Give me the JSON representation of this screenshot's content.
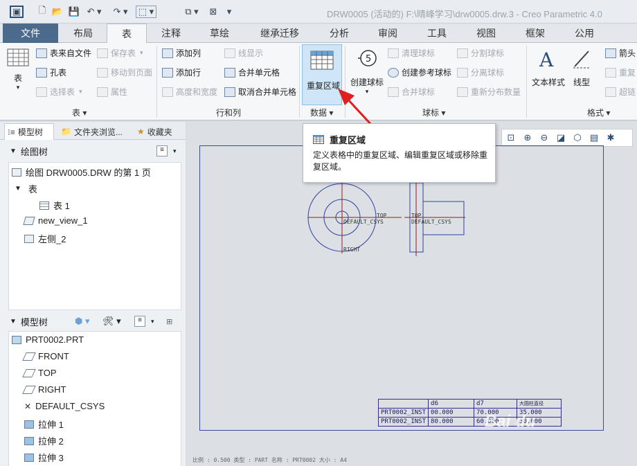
{
  "titlebar": {
    "window_title": "DRW0005 (活动的) F:\\晴峰学习\\drw0005.drw.3 - Creo Parametric 4.0"
  },
  "tabs": [
    {
      "label": "文件"
    },
    {
      "label": "布局"
    },
    {
      "label": "表"
    },
    {
      "label": "注释"
    },
    {
      "label": "草绘"
    },
    {
      "label": "继承迁移"
    },
    {
      "label": "分析"
    },
    {
      "label": "审阅"
    },
    {
      "label": "工具"
    },
    {
      "label": "视图"
    },
    {
      "label": "框架"
    },
    {
      "label": "公用"
    }
  ],
  "ribbon": {
    "table_group": {
      "label": "表 ▾",
      "table_btn": "表",
      "table_from_file": "表来自文件",
      "save_table": "保存表",
      "hole_table": "孔表",
      "select_table": "选择表",
      "move_to_page": "移动到页面",
      "properties": "属性"
    },
    "rows_cols_group": {
      "label": "行和列",
      "add_column": "添加列",
      "add_row": "添加行",
      "height_width": "高度和宽度",
      "line_display": "线显示",
      "merge_cells": "合并单元格",
      "unmerge_cells": "取消合并单元格"
    },
    "data_group": {
      "label": "数据 ▾",
      "repeat_region": "重复区域"
    },
    "balloon_group": {
      "label": "球标 ▾",
      "create_balloon": "创建球标",
      "clean_balloons": "清理球标",
      "create_ref_balloon": "创建参考球标",
      "merge_balloons": "合并球标",
      "split_balloon": "分割球标",
      "detach_balloon": "分离球标",
      "redistribute_qty": "重新分布数量"
    },
    "format_group": {
      "label": "格式 ▾",
      "text_style": "文本样式",
      "line_style": "线型",
      "arrow": "箭头",
      "repeat": "重复",
      "hyperlink": "超链"
    }
  },
  "left_panel": {
    "tabs": [
      {
        "label": "模型树"
      },
      {
        "label": "文件夹浏览..."
      },
      {
        "label": "收藏夹"
      }
    ],
    "drawing_tree": {
      "title": "绘图树",
      "nodes": [
        {
          "label": "绘图 DRW0005.DRW 的第 1 页"
        },
        {
          "label": "表"
        },
        {
          "label": "表 1"
        },
        {
          "label": "new_view_1"
        },
        {
          "label": "左侧_2"
        }
      ]
    },
    "model_tree": {
      "title": "模型树",
      "nodes": [
        {
          "label": "PRT0002.PRT"
        },
        {
          "label": "FRONT"
        },
        {
          "label": "TOP"
        },
        {
          "label": "RIGHT"
        },
        {
          "label": "DEFAULT_CSYS"
        },
        {
          "label": "拉伸 1"
        },
        {
          "label": "拉伸 2"
        },
        {
          "label": "拉伸 3"
        }
      ]
    }
  },
  "tooltip": {
    "title": "重复区域",
    "description": "定义表格中的重复区域、编辑重复区域或移除重复区域。"
  },
  "drawing": {
    "view_labels": {
      "top1": "TOP",
      "csys1": "DEFAULT_CSYS",
      "right": "RIGHT",
      "top2": "TOP",
      "csys2": "DEFAULT_CSYS"
    },
    "table": {
      "header": [
        "",
        "d6",
        "d7",
        "大圆柱直径"
      ],
      "rows": [
        [
          "PRT0002_INST",
          "00.000",
          "70.000",
          "35.000"
        ],
        [
          "PRT0002_INST",
          "80.000",
          "60.000",
          "30.000"
        ]
      ]
    },
    "status": "比例 : 0.500    类型 : PART    名称 : PRT0002    大小 : A4"
  },
  "watermark": "Bai du"
}
